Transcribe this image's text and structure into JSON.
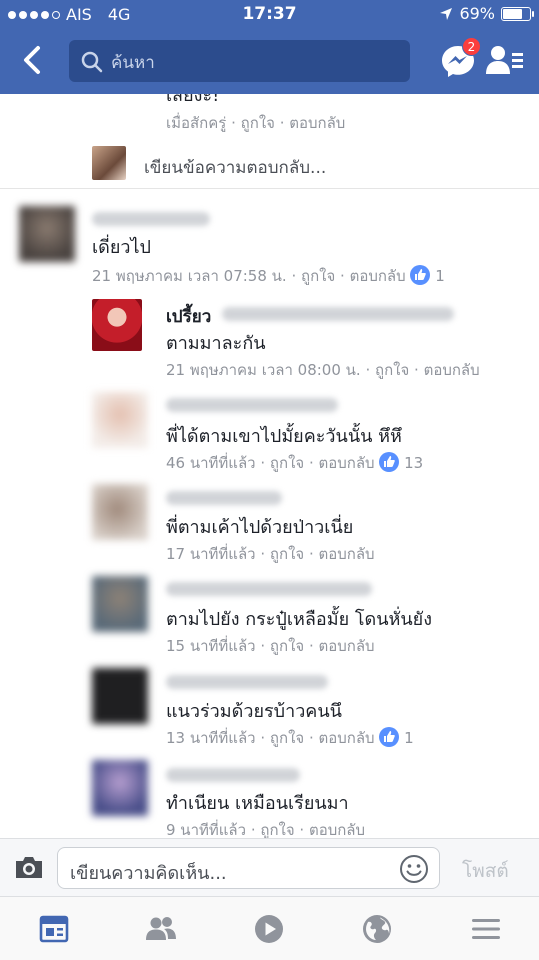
{
  "status": {
    "carrier": "AIS",
    "network": "4G",
    "time": "17:37",
    "battery": "69%"
  },
  "header": {
    "search_placeholder": "ค้นหา",
    "messenger_badge": "2"
  },
  "previous_reply": {
    "text_fragment": "เสียงะ!",
    "time": "เมื่อสักครู่",
    "like": "ถูกใจ",
    "reply": "ตอบกลับ"
  },
  "reply_prompt": "เขียนข้อความตอบกลับ...",
  "comment": {
    "text": "เดี่ยวไป",
    "time": "21 พฤษภาคม เวลา 07:58 น.",
    "like": "ถูกใจ",
    "reply": "ตอบกลับ",
    "like_count": "1"
  },
  "replies": [
    {
      "name": "เปรี้ยว",
      "text": "ตามมาละกัน",
      "time": "21 พฤษภาคม เวลา 08:00 น.",
      "like": "ถูกใจ",
      "reply": "ตอบกลับ",
      "like_count": ""
    },
    {
      "name": "",
      "text": "พี่ได้ตามเขาไปมั้ยคะวันนั้น หึหึ",
      "time": "46 นาทีที่แล้ว",
      "like": "ถูกใจ",
      "reply": "ตอบกลับ",
      "like_count": "13"
    },
    {
      "name": "",
      "text": "พี่ตามเค้าไปด้วยป่าวเนี่ย",
      "time": "17 นาทีที่แล้ว",
      "like": "ถูกใจ",
      "reply": "ตอบกลับ",
      "like_count": ""
    },
    {
      "name": "",
      "text": "ตามไปยัง กระปู๋เหลือมั้ย โดนหั่นยัง",
      "time": "15 นาทีที่แล้ว",
      "like": "ถูกใจ",
      "reply": "ตอบกลับ",
      "like_count": ""
    },
    {
      "name": "",
      "text": "แนวร่วมด้วยรบ้าวคนนึ",
      "time": "13 นาทีที่แล้ว",
      "like": "ถูกใจ",
      "reply": "ตอบกลับ",
      "like_count": "1"
    },
    {
      "name": "",
      "text": "ทำเนียน เหมือนเรียนมา",
      "time": "9 นาทีที่แล้ว",
      "like": "ถูกใจ",
      "reply": "ตอบกลับ",
      "like_count": ""
    }
  ],
  "composer": {
    "placeholder": "เขียนความคิดเห็น...",
    "post": "โพสต์"
  },
  "colors": {
    "brand": "#4267b2",
    "like_blue": "#5890ff",
    "meta_gray": "#90949c"
  },
  "icons": [
    "back-icon",
    "search-icon",
    "messenger-icon",
    "friend-requests-icon",
    "camera-icon",
    "smiley-icon",
    "news-feed-icon",
    "friends-icon",
    "video-icon",
    "globe-icon",
    "menu-icon",
    "like-icon"
  ]
}
